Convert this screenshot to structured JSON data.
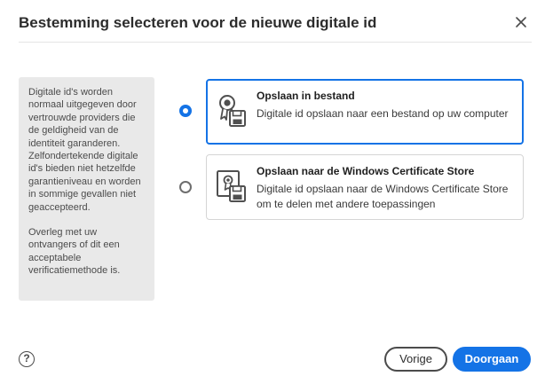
{
  "dialog": {
    "title": "Bestemming selecteren voor de nieuwe digitale id"
  },
  "info": {
    "paragraph_1": "Digitale id's worden normaal uitgegeven door vertrouwde providers die de geldigheid van de identiteit garanderen. Zelfondertekende digitale id's bieden niet hetzelfde garantieniveau en worden in sommige gevallen niet geaccepteerd.",
    "paragraph_2": "Overleg met uw ontvangers of dit een acceptabele verificatiemethode is."
  },
  "options": [
    {
      "title": "Opslaan in bestand",
      "description": "Digitale id opslaan naar een bestand op uw computer",
      "selected": true,
      "icon": "certificate-file-icon"
    },
    {
      "title": "Opslaan naar de Windows Certificate Store",
      "description": "Digitale id opslaan naar de Windows Certificate Store om te delen met andere toepassingen",
      "selected": false,
      "icon": "certificate-store-icon"
    }
  ],
  "footer": {
    "help_glyph": "?",
    "back_label": "Vorige",
    "continue_label": "Doorgaan"
  },
  "colors": {
    "accent": "#1473e6",
    "info_background": "#e9e9e9",
    "text": "#2c2c2c"
  }
}
